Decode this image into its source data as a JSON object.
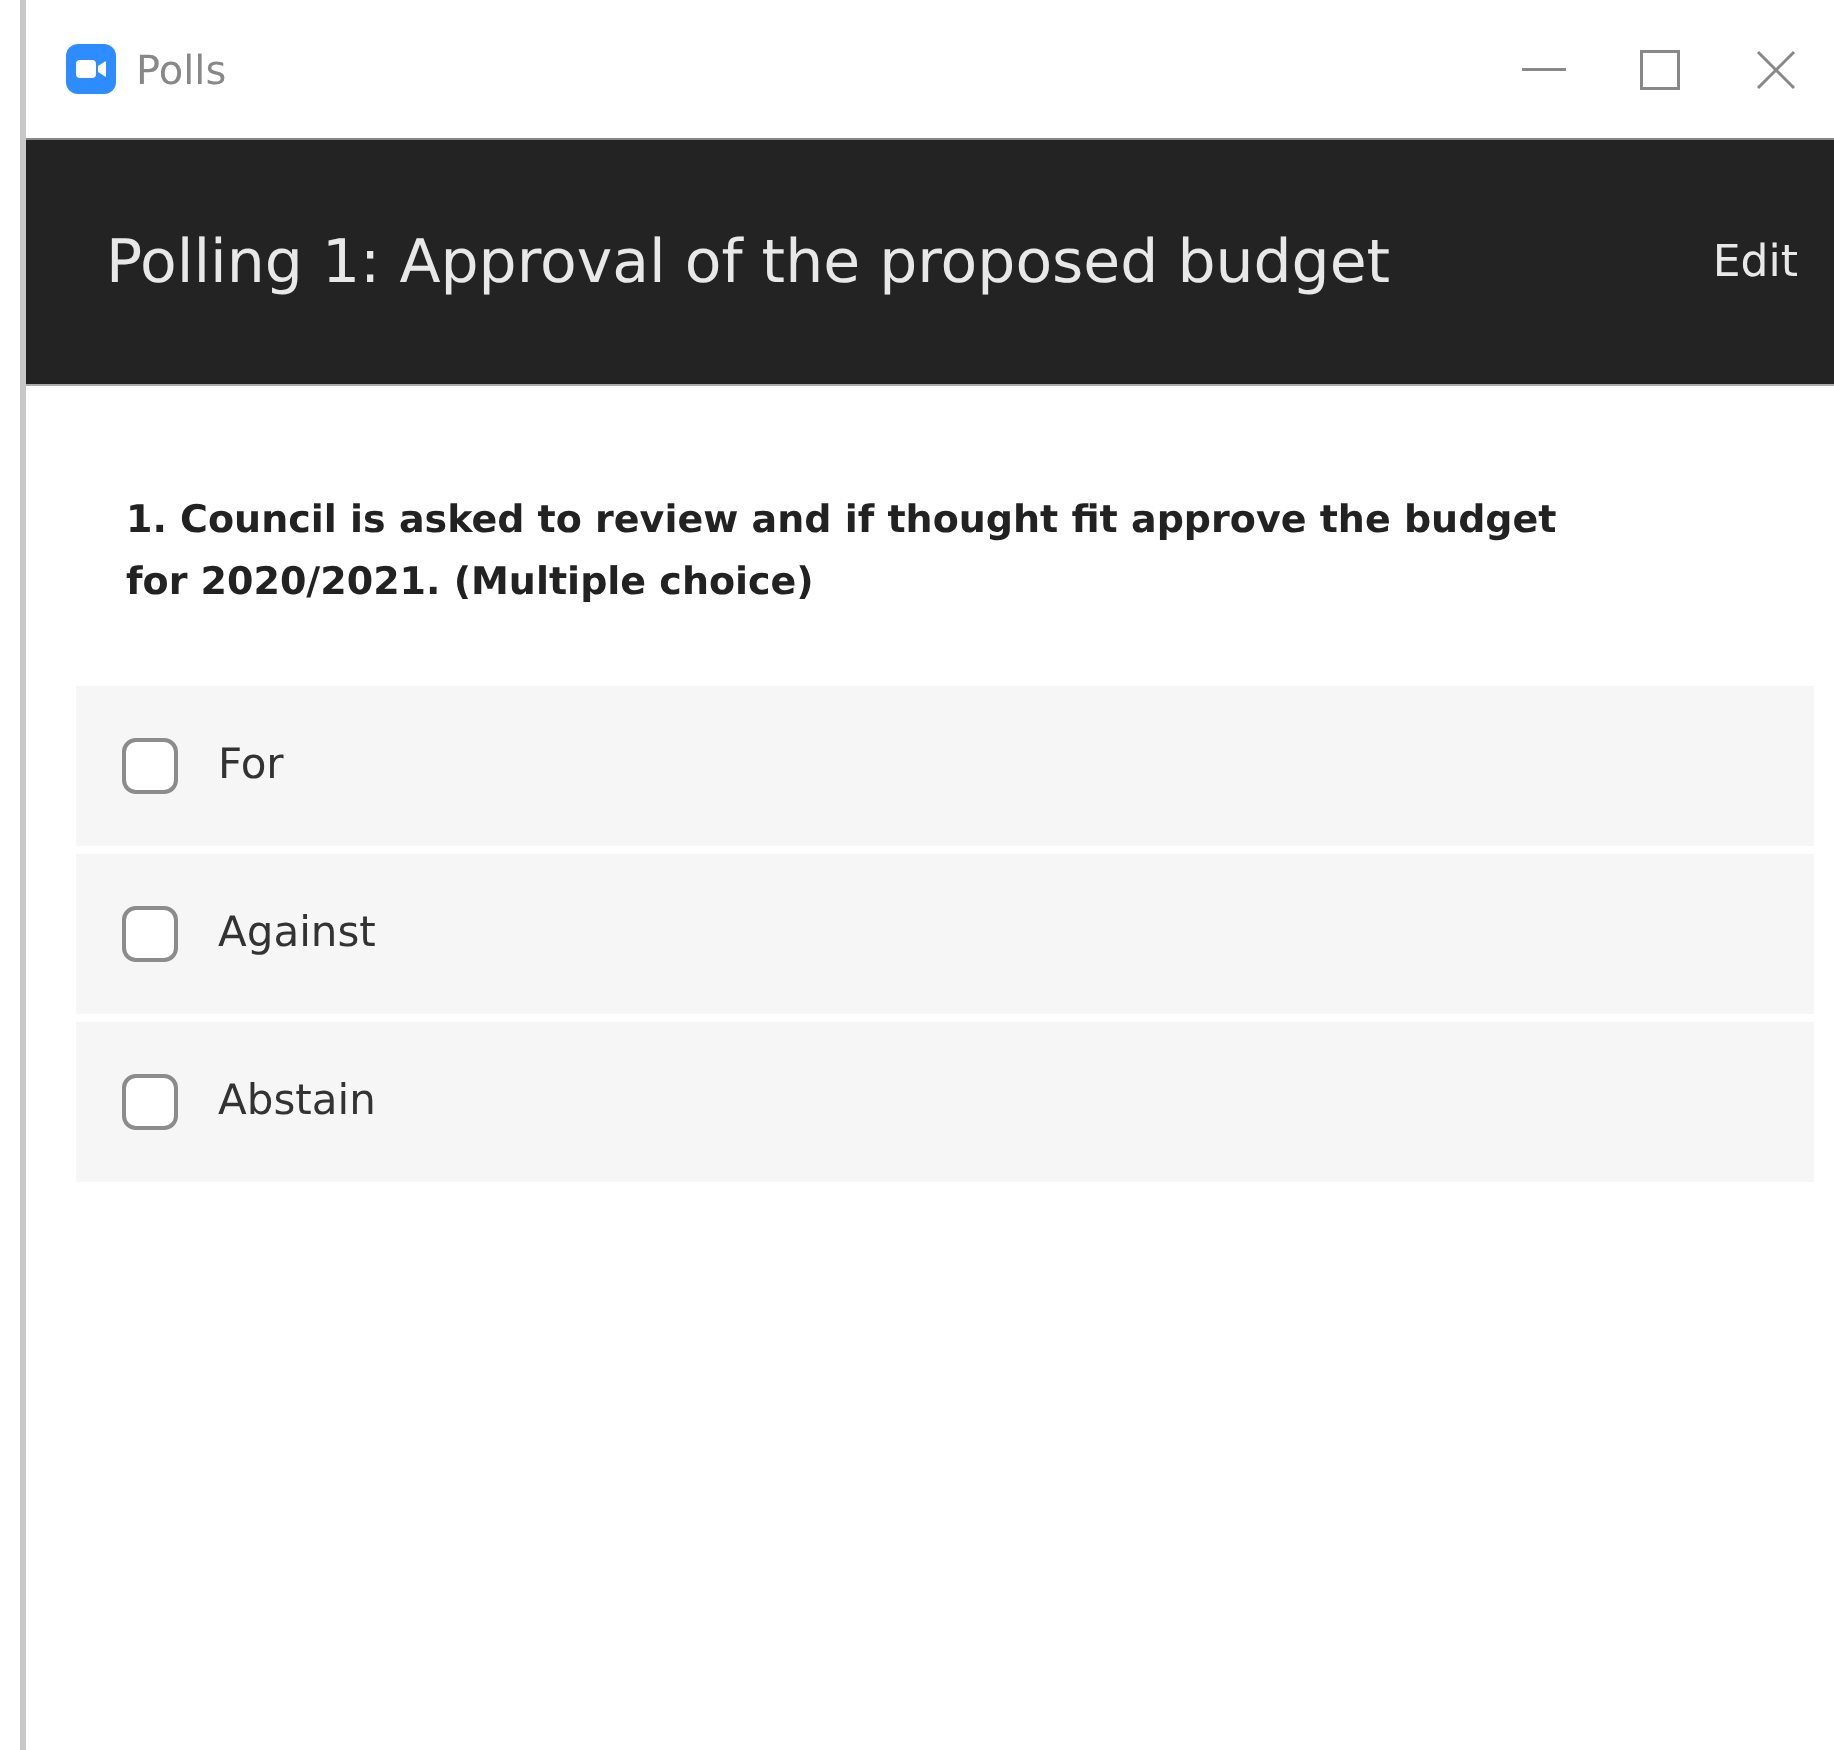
{
  "window": {
    "title": "Polls"
  },
  "header": {
    "title": "Polling 1: Approval of the proposed budget",
    "action": "Edit"
  },
  "question": "1. Council is asked to review and if thought fit approve the budget for 2020/2021. (Multiple choice)",
  "options": [
    {
      "label": "For",
      "checked": false
    },
    {
      "label": "Against",
      "checked": false
    },
    {
      "label": "Abstain",
      "checked": false
    }
  ]
}
